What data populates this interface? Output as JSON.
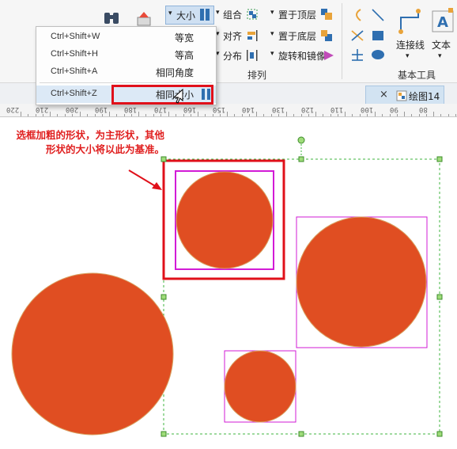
{
  "ribbon": {
    "size_button": "大小",
    "group_btn": "组合",
    "bring_front": "置于顶层",
    "send_back": "置于底层",
    "align": "对齐",
    "distribute": "分布",
    "rotate_mirror": "旋转和镜像",
    "arrange_label": "排列",
    "text_tool": "文本",
    "connector": "连接线",
    "basic_tools_label": "基本工具"
  },
  "menu": {
    "items": [
      {
        "label": "等宽",
        "shortcut": "Ctrl+Shift+W"
      },
      {
        "label": "等高",
        "shortcut": "Ctrl+Shift+H"
      },
      {
        "label": "相同角度",
        "shortcut": "Ctrl+Shift+A"
      },
      {
        "label": "相同大小",
        "shortcut": "Ctrl+Shift+Z"
      }
    ]
  },
  "tabs": {
    "doc_tab": "绘图14",
    "close": "×"
  },
  "ruler": {
    "labels": [
      "220",
      "210",
      "200",
      "190",
      "180",
      "170",
      "160",
      "150",
      "140",
      "130",
      "120",
      "110",
      "100",
      "90",
      "80"
    ]
  },
  "annotation": {
    "text": "选框加粗的形状，为主形状，其他形状的大小将以此为基准。"
  },
  "colors": {
    "circle_fill": "#e04e22",
    "highlight_red": "#e0101a",
    "shape_select": "#d21bd6",
    "group_select": "#3fb63f",
    "menu_highlight": "#dce9f6"
  }
}
